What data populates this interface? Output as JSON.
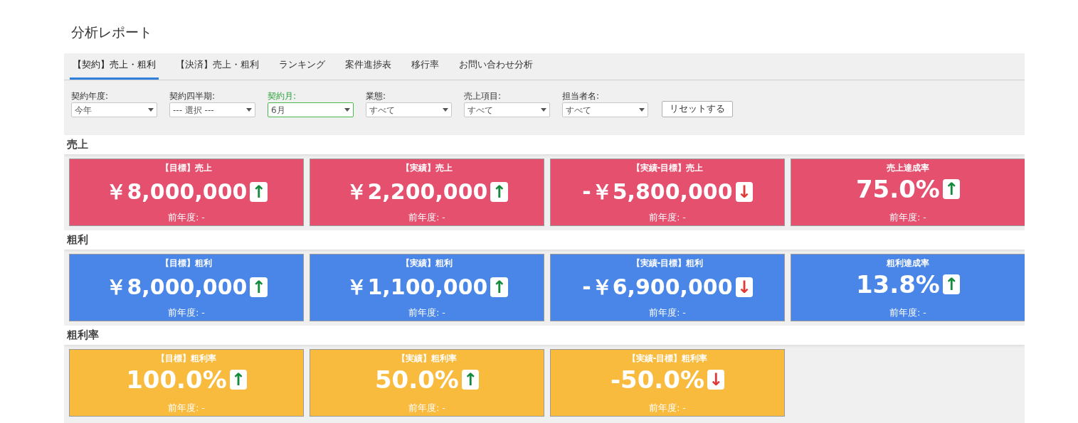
{
  "title": "分析レポート",
  "tabs": [
    {
      "label": "【契約】売上・粗利",
      "selected": true
    },
    {
      "label": "【決済】売上・粗利",
      "selected": false
    },
    {
      "label": "ランキング",
      "selected": false
    },
    {
      "label": "案件進捗表",
      "selected": false
    },
    {
      "label": "移行率",
      "selected": false
    },
    {
      "label": "お問い合わせ分析",
      "selected": false
    }
  ],
  "filters": [
    {
      "label": "契約年度:",
      "value": "今年",
      "active": false
    },
    {
      "label": "契約四半期:",
      "value": "--- 選択 ---",
      "active": false
    },
    {
      "label": "契約月:",
      "value": "6月",
      "active": true
    },
    {
      "label": "業態:",
      "value": "すべて",
      "active": false
    },
    {
      "label": "売上項目:",
      "value": "すべて",
      "active": false
    },
    {
      "label": "担当者名:",
      "value": "すべて",
      "active": false
    }
  ],
  "reset_button": "リセットする",
  "sections": [
    {
      "title": "売上",
      "color": "#e5506f",
      "cards": [
        {
          "kind": "amount",
          "title": "【目標】売上",
          "value": "￥8,000,000",
          "arrow": "↑",
          "color": "#148a3c",
          "previous": "前年度: -"
        },
        {
          "kind": "amount",
          "title": "【実績】売上",
          "value": "￥2,200,000",
          "arrow": "↑",
          "color": "#148a3c",
          "previous": "前年度: -"
        },
        {
          "kind": "amount",
          "title": "【実績-目標】売上",
          "value": "-￥5,800,000",
          "arrow": "↓",
          "color": "#e03a39",
          "previous": "前年度: -"
        },
        {
          "kind": "rate",
          "title": "売上達成率",
          "value": "75.0%",
          "arrow": "↑",
          "color": "#148a3c",
          "previous": "前年度: -"
        }
      ]
    },
    {
      "title": "粗利",
      "color": "#4a86e8",
      "cards": [
        {
          "kind": "amount",
          "title": "【目標】粗利",
          "value": "￥8,000,000",
          "arrow": "↑",
          "color": "#148a3c",
          "previous": "前年度: -"
        },
        {
          "kind": "amount",
          "title": "【実績】粗利",
          "value": "￥1,100,000",
          "arrow": "↑",
          "color": "#148a3c",
          "previous": "前年度: -"
        },
        {
          "kind": "amount",
          "title": "【実績-目標】粗利",
          "value": "-￥6,900,000",
          "arrow": "↓",
          "color": "#e03a39",
          "previous": "前年度: -"
        },
        {
          "kind": "rate",
          "title": "粗利達成率",
          "value": "13.8%",
          "arrow": "↑",
          "color": "#148a3c",
          "previous": "前年度: -"
        }
      ]
    },
    {
      "title": "粗利率",
      "color": "#f9bb3e",
      "cards": [
        {
          "kind": "rate",
          "title": "【目標】粗利率",
          "value": "100.0%",
          "arrow": "↑",
          "color": "#148a3c",
          "previous": "前年度: -"
        },
        {
          "kind": "rate",
          "title": "【実績】粗利率",
          "value": "50.0%",
          "arrow": "↑",
          "color": "#148a3c",
          "previous": "前年度: -"
        },
        {
          "kind": "rate",
          "title": "【実績-目標】粗利率",
          "value": "-50.0%",
          "arrow": "↓",
          "color": "#e03a39",
          "previous": "前年度: -"
        }
      ]
    }
  ]
}
